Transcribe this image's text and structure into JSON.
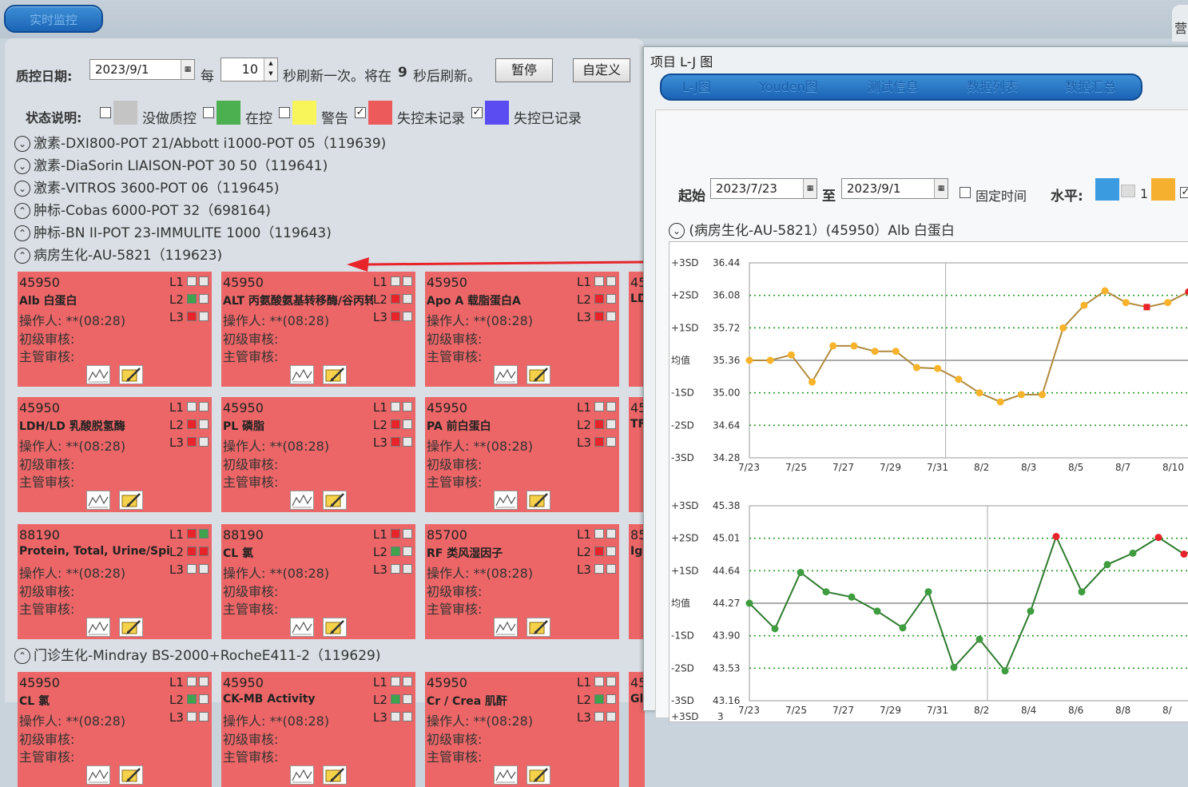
{
  "top_tab": {
    "label": "实时监控",
    "right_tab": "营"
  },
  "toolbar": {
    "qc_date_label": "质控日期:",
    "qc_date": "2023/9/1",
    "every": "每",
    "interval": "10",
    "refresh_text": "秒刷新一次。将在",
    "countdown": "9",
    "refresh_suffix": "秒后刷新。",
    "pause_button": "暂停",
    "custom_button": "自定义"
  },
  "legend": {
    "label": "状态说明:",
    "items": [
      {
        "text": "没做质控",
        "color": "#c4c4c4",
        "checked": false
      },
      {
        "text": "在控",
        "color": "#4caf50",
        "checked": false
      },
      {
        "text": "警告",
        "color": "#f7f55a",
        "checked": false
      },
      {
        "text": "失控未记录",
        "color": "#ec5a5c",
        "checked": true
      },
      {
        "text": "失控已记录",
        "color": "#5a4cf0",
        "checked": true
      }
    ]
  },
  "groups": [
    {
      "name": "激素-DXI800-POT 21/Abbott i1000-POT 05（119639)",
      "expanded": false
    },
    {
      "name": "激素-DiaSorin LIAISON-POT 30 50（119641)",
      "expanded": false
    },
    {
      "name": "激素-VITROS 3600-POT 06（119645)",
      "expanded": false
    },
    {
      "name": "肿标-Cobas 6000-POT 32（698164)",
      "expanded": true
    },
    {
      "name": "肿标-BN II-POT 23-IMMULITE 1000（119643)",
      "expanded": true
    },
    {
      "name": "病房生化-AU-5821（119623)",
      "expanded": true
    },
    {
      "name": "门诊生化-Mindray BS-2000+RocheE411-2（119629)",
      "expanded": true
    }
  ],
  "card_labels": {
    "operator": "操作人: **(08:28)",
    "review1": "初级审核:",
    "review2": "主管审核:"
  },
  "cards": [
    {
      "id": "45950",
      "name": "Alb 白蛋白",
      "levels": [
        [
          "#e8e8e8",
          "#e8e8e8"
        ],
        [
          "#3fa34d",
          "#e8e8e8"
        ],
        [
          "#e8242a",
          "#e8e8e8"
        ]
      ]
    },
    {
      "id": "45950",
      "name": "ALT 丙氨酸氨基转移酶/谷丙转",
      "levels": [
        [
          "#e8e8e8",
          "#e8e8e8"
        ],
        [
          "#e8242a",
          "#e8e8e8"
        ],
        [
          "#e8242a",
          "#e8e8e8"
        ]
      ]
    },
    {
      "id": "45950",
      "name": "Apo A 载脂蛋白A",
      "levels": [
        [
          "#e8e8e8",
          "#e8e8e8"
        ],
        [
          "#e8242a",
          "#e8e8e8"
        ],
        [
          "#e8242a",
          "#e8e8e8"
        ]
      ]
    },
    {
      "id": "45950",
      "name": "LDH/LD 乳酸脱氢酶",
      "levels": [
        [
          "#e8e8e8",
          "#e8e8e8"
        ],
        [
          "#e8242a",
          "#e8e8e8"
        ],
        [
          "#e8242a",
          "#e8e8e8"
        ]
      ]
    },
    {
      "id": "45950",
      "name": "PL 磷脂",
      "levels": [
        [
          "#e8e8e8",
          "#e8e8e8"
        ],
        [
          "#e8242a",
          "#e8e8e8"
        ],
        [
          "#e8242a",
          "#e8e8e8"
        ]
      ]
    },
    {
      "id": "45950",
      "name": "PA 前白蛋白",
      "levels": [
        [
          "#e8e8e8",
          "#e8e8e8"
        ],
        [
          "#e8242a",
          "#e8e8e8"
        ],
        [
          "#e8242a",
          "#e8e8e8"
        ]
      ]
    },
    {
      "id": "88190",
      "name": "Protein, Total, Urine/Spin",
      "levels": [
        [
          "#e8242a",
          "#3fa34d"
        ],
        [
          "#e8242a",
          "#e8242a"
        ],
        [
          "#e8e8e8",
          "#e8e8e8"
        ]
      ]
    },
    {
      "id": "88190",
      "name": "CL 氯",
      "levels": [
        [
          "#e8242a",
          "#e8e8e8"
        ],
        [
          "#3fa34d",
          "#e8e8e8"
        ],
        [
          "#e8e8e8",
          "#e8e8e8"
        ]
      ]
    },
    {
      "id": "85700",
      "name": "RF 类风湿因子",
      "levels": [
        [
          "#e8e8e8",
          "#e8e8e8"
        ],
        [
          "#e8242a",
          "#e8e8e8"
        ],
        [
          "#e8e8e8",
          "#e8e8e8"
        ]
      ]
    },
    {
      "id": "45950",
      "name": "CL 氯",
      "levels": [
        [
          "#e8e8e8",
          "#e8e8e8"
        ],
        [
          "#3fa34d",
          "#e8e8e8"
        ],
        [
          "#e8e8e8",
          "#e8e8e8"
        ]
      ]
    },
    {
      "id": "45950",
      "name": "CK-MB Activity",
      "levels": [
        [
          "#e8e8e8",
          "#e8e8e8"
        ],
        [
          "#3fa34d",
          "#e8e8e8"
        ],
        [
          "#e8e8e8",
          "#e8e8e8"
        ]
      ]
    },
    {
      "id": "45950",
      "name": "Cr / Crea 肌酐",
      "levels": [
        [
          "#e8e8e8",
          "#e8e8e8"
        ],
        [
          "#3fa34d",
          "#e8e8e8"
        ],
        [
          "#e8e8e8",
          "#e8e8e8"
        ]
      ]
    }
  ],
  "peek_cards": [
    {
      "id": "45",
      "name": "LD"
    },
    {
      "id": "45",
      "name": "TF"
    },
    {
      "id": "85",
      "name": "Ig"
    },
    {
      "id": "45",
      "name": "Gl"
    }
  ],
  "level_labels": [
    "L1",
    "L2",
    "L3"
  ],
  "lj_window": {
    "title": "项目 L-J 图",
    "tabs": [
      "L-J图",
      "Youden图",
      "测试信息",
      "数据列表",
      "数据汇总"
    ],
    "start_label": "起始",
    "start_date": "2023/7/23",
    "to_label": "至",
    "end_date": "2023/9/1",
    "fixed_time_label": "固定时间",
    "level_label": "水平:",
    "level_1": "1",
    "level_colors": [
      "#3b9be0",
      "#f5b030"
    ],
    "chart_header": "(病房生化-AU-5821）(45950）Alb 白蛋白"
  },
  "chart_data": [
    {
      "type": "line",
      "sd_labels": [
        "+3SD",
        "+2SD",
        "+1SD",
        "均值",
        "-1SD",
        "-2SD",
        "-3SD"
      ],
      "y_ticks": [
        "36.44",
        "36.08",
        "35.72",
        "35.36",
        "35.00",
        "34.64",
        "34.28"
      ],
      "ylim": [
        34.28,
        36.44
      ],
      "x_ticks": [
        "7/23",
        "7/25",
        "7/27",
        "7/29",
        "7/31",
        "8/2",
        "8/3",
        "8/5",
        "8/7",
        "8/10"
      ],
      "line_color": "#b08a3c",
      "point_color": "#f7b32b",
      "values": [
        35.36,
        35.36,
        35.42,
        35.12,
        35.52,
        35.52,
        35.46,
        35.46,
        35.28,
        35.27,
        35.15,
        35.0,
        34.9,
        34.98,
        34.98,
        35.72,
        35.97,
        36.13,
        36.0,
        35.95,
        36.0,
        36.12,
        36.08
      ],
      "red_indices": [
        19,
        21,
        22
      ],
      "divider_index": 9
    },
    {
      "type": "line",
      "sd_labels": [
        "+3SD",
        "+2SD",
        "+1SD",
        "均值",
        "-1SD",
        "-2SD",
        "-3SD"
      ],
      "y_ticks": [
        "45.38",
        "45.01",
        "44.64",
        "44.27",
        "43.90",
        "43.53",
        "43.16"
      ],
      "ylim": [
        43.16,
        45.38
      ],
      "x_ticks": [
        "7/23",
        "7/25",
        "7/27",
        "7/29",
        "7/31",
        "8/2",
        "8/4",
        "8/6",
        "8/8",
        "8/"
      ],
      "line_color": "#2e7a2e",
      "point_color": "#3f9c3f",
      "values": [
        44.27,
        43.98,
        44.62,
        44.4,
        44.34,
        44.18,
        43.99,
        44.4,
        43.54,
        43.86,
        43.5,
        44.18,
        45.03,
        44.4,
        44.71,
        44.84,
        45.02,
        44.83,
        44.94
      ],
      "red_indices": [
        12,
        16,
        17,
        18
      ],
      "divider_index": 9
    }
  ],
  "third_chart_peek": {
    "sd": "+3SD",
    "tick": "3"
  }
}
